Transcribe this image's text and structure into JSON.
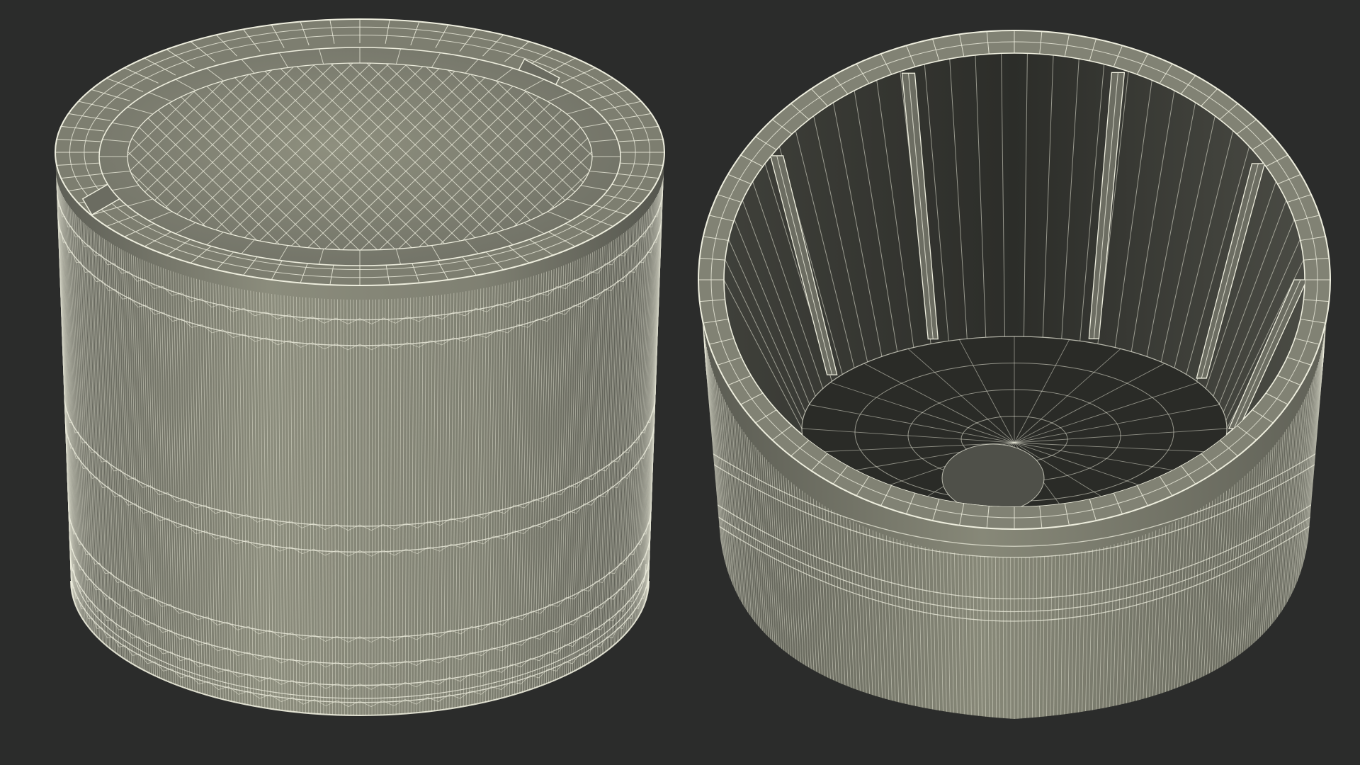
{
  "render": {
    "background": "#2b2c2b",
    "surface_light": "#8d8e7d",
    "surface_mid": "#74756a",
    "surface_dark": "#4d4e47",
    "interior_dark": "#262723",
    "wire_color": "#eeeede"
  },
  "objects": [
    {
      "name": "cap-exterior-top-view",
      "view": "exterior"
    },
    {
      "name": "cap-interior-open-view",
      "view": "interior"
    }
  ]
}
